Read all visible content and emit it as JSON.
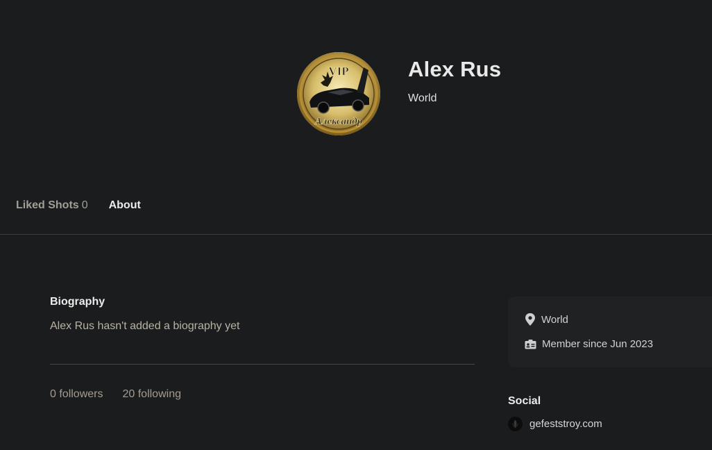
{
  "profile": {
    "name": "Alex Rus",
    "location": "World",
    "avatar_badge_text": "VIP",
    "avatar_caption": "Александр"
  },
  "tabs": [
    {
      "label": "Liked Shots",
      "count": "0",
      "active": false
    },
    {
      "label": "About",
      "active": true
    }
  ],
  "about": {
    "biography_heading": "Biography",
    "biography_text": "Alex Rus hasn't added a biography yet",
    "followers": "0 followers",
    "following": "20 following"
  },
  "sidebar": {
    "location": "World",
    "location_icon": "map-pin-icon",
    "member_since": "Member since Jun 2023",
    "member_icon": "id-card-icon",
    "social_heading": "Social",
    "social_links": [
      {
        "label": "gefeststroy.com",
        "icon": "website-icon"
      }
    ]
  }
}
